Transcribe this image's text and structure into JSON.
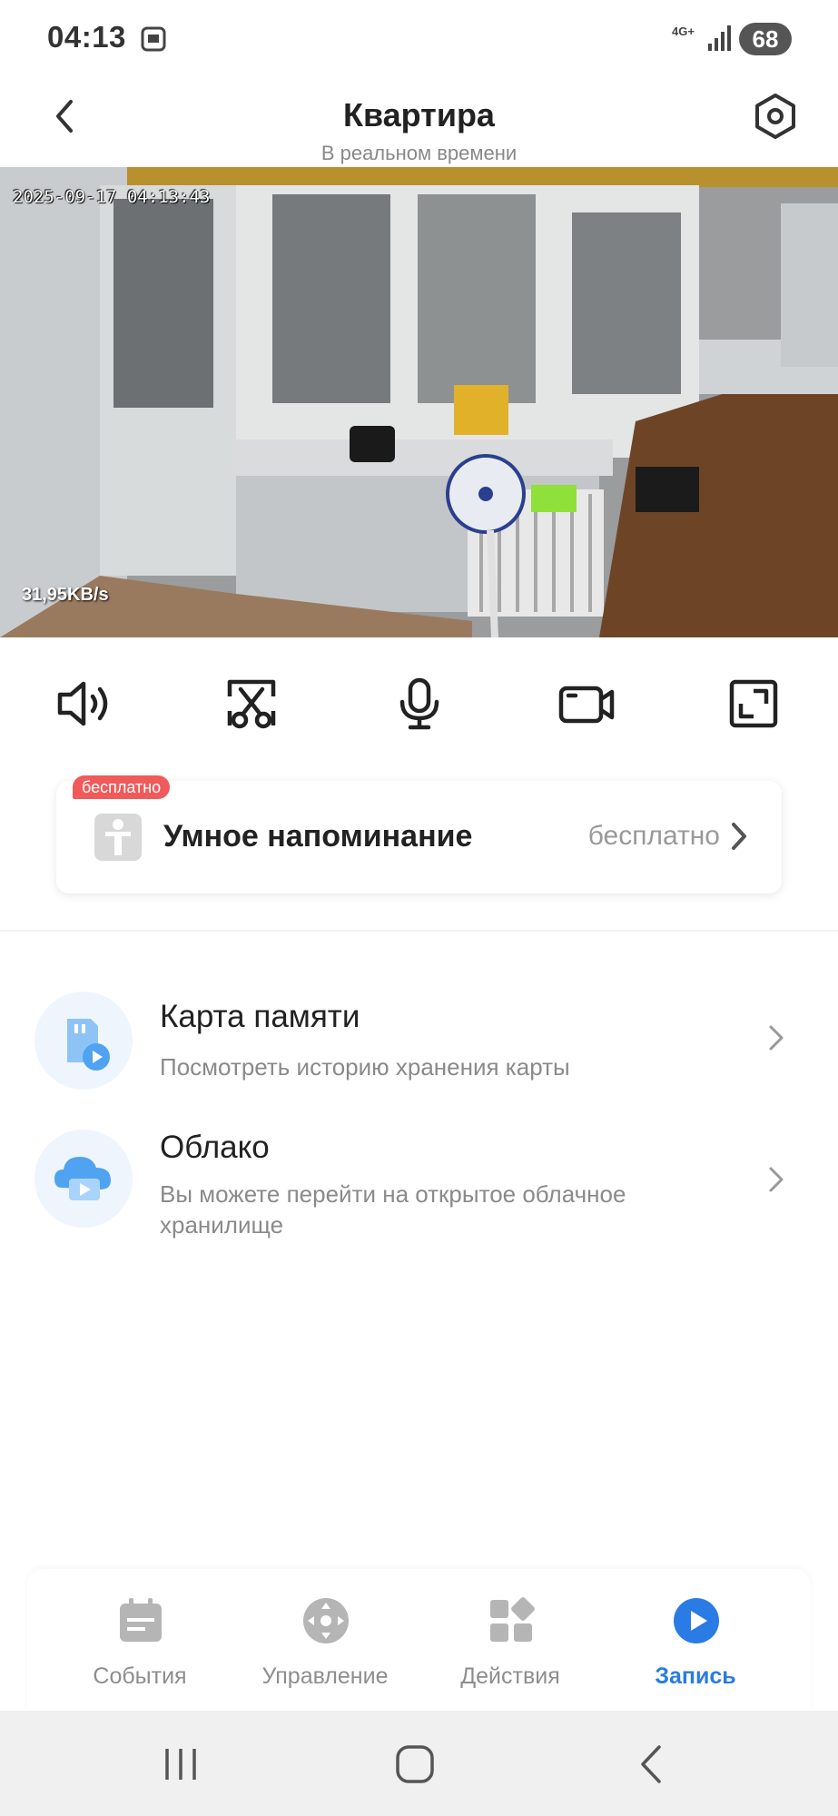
{
  "status_bar": {
    "time": "04:13",
    "network": "4G+",
    "battery": "68"
  },
  "header": {
    "title": "Квартира",
    "subtitle": "В реальном времени"
  },
  "video": {
    "timestamp": "2025-09-17 04:13:43",
    "bitrate": "31,95KB/s"
  },
  "controls": [
    {
      "name": "sound-icon"
    },
    {
      "name": "screenshot-icon"
    },
    {
      "name": "microphone-icon"
    },
    {
      "name": "record-video-icon"
    },
    {
      "name": "fullscreen-icon"
    }
  ],
  "smart_reminder": {
    "badge": "бесплатно",
    "title": "Умное напоминание",
    "price": "бесплатно"
  },
  "storage": {
    "memory_card": {
      "title": "Карта памяти",
      "subtitle": "Посмотреть историю хранения карты"
    },
    "cloud": {
      "title": "Облако",
      "subtitle": "Вы можете перейти на открытое облачное хранилище"
    }
  },
  "tabs": [
    {
      "label": "События",
      "active": false
    },
    {
      "label": "Управление",
      "active": false
    },
    {
      "label": "Действия",
      "active": false
    },
    {
      "label": "Запись",
      "active": true
    }
  ],
  "colors": {
    "accent": "#2a7be4",
    "badge": "#f05a5a",
    "inactive": "#8e8e8e"
  }
}
